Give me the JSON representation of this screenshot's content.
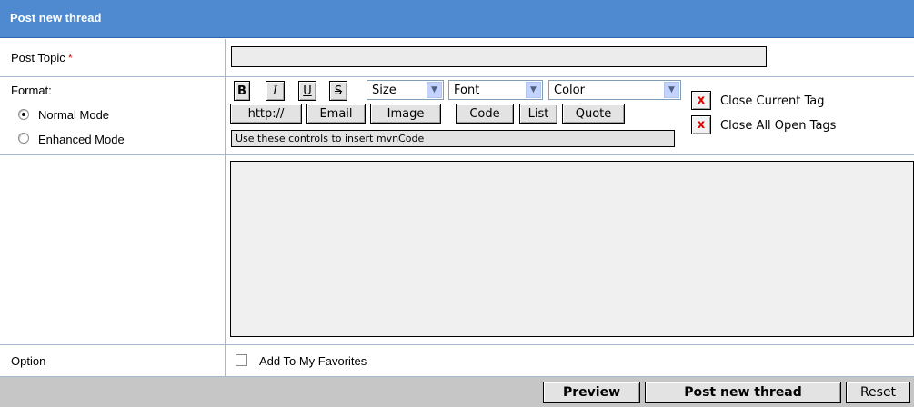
{
  "header": {
    "title": "Post new thread"
  },
  "topic": {
    "label": "Post Topic",
    "required_mark": "*",
    "value": ""
  },
  "format": {
    "label": "Format:",
    "modes": [
      {
        "label": "Normal Mode",
        "checked": true
      },
      {
        "label": "Enhanced Mode",
        "checked": false
      }
    ]
  },
  "toolbar": {
    "bold": "B",
    "italic": "I",
    "underline": "U",
    "strike": "S",
    "size": "Size",
    "font": "Font",
    "color": "Color",
    "http": "http://",
    "email": "Email",
    "image": "Image",
    "code": "Code",
    "list": "List",
    "quote": "Quote",
    "hint": "Use these controls to insert mvnCode",
    "close_current_x": "x",
    "close_current": "Close Current Tag",
    "close_all_x": "x",
    "close_all": "Close All Open Tags"
  },
  "message": {
    "value": ""
  },
  "option": {
    "label": "Option",
    "favorites": "Add To My Favorites",
    "favorites_checked": false
  },
  "footer": {
    "preview": "Preview",
    "post": "Post new thread",
    "reset": "Reset"
  },
  "colors": {
    "header": "#4f8ad0",
    "footer": "#c6c6c6",
    "grid": "#a4b8d2"
  }
}
